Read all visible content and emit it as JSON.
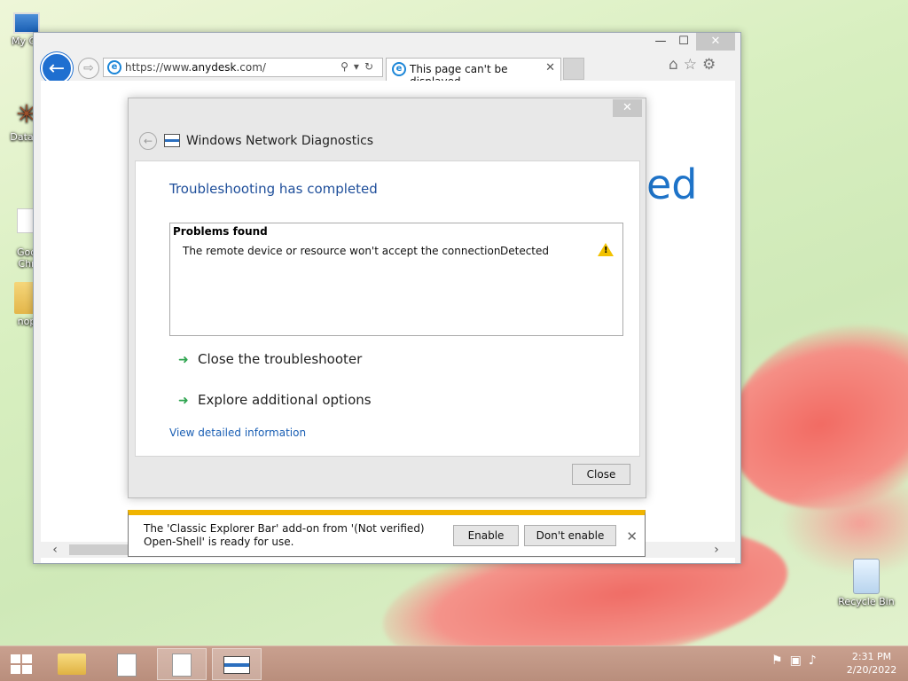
{
  "desktop": {
    "icons": [
      {
        "label": "My Co",
        "icon": "computer-icon"
      },
      {
        "label": "DataW",
        "icon": "datawrapper-icon"
      },
      {
        "label": "Goo\nChr",
        "icon": "chrome-shortcut-icon"
      },
      {
        "label": "nop",
        "icon": "folder-icon"
      },
      {
        "label": "Recycle Bin",
        "icon": "recycle-bin-icon"
      }
    ]
  },
  "browser": {
    "address": "https://www.anydesk.com/",
    "address_host": "anydesk",
    "address_prefix": "https://www.",
    "address_suffix": ".com/",
    "tab_title": "This page can't be displayed",
    "bg_text_fragment": "ed",
    "window_buttons": {
      "minimize": "—",
      "maximize": "☐",
      "close": "✕"
    }
  },
  "dialog": {
    "title": "Windows Network Diagnostics",
    "heading": "Troubleshooting has completed",
    "problems_title": "Problems found",
    "problems": [
      {
        "text": "The remote device or resource won't accept the connection",
        "status": "Detected",
        "icon": "warning-icon"
      }
    ],
    "options": [
      {
        "label": "Close the troubleshooter"
      },
      {
        "label": "Explore additional options"
      }
    ],
    "detail_link": "View detailed information",
    "close_button": "Close"
  },
  "notification": {
    "line1": "The 'Classic Explorer Bar' add-on from '(Not verified)",
    "line2": "Open-Shell' is ready for use.",
    "enable": "Enable",
    "dont_enable": "Don't enable"
  },
  "taskbar": {
    "time": "2:31 PM",
    "date": "2/20/2022"
  },
  "colors": {
    "accent": "#1f6fd0",
    "heading": "#1e4e9a",
    "link": "#1a5fb4",
    "warning": "#f2c200",
    "notif_bar": "#f0b400",
    "taskbar": "#c09684"
  }
}
